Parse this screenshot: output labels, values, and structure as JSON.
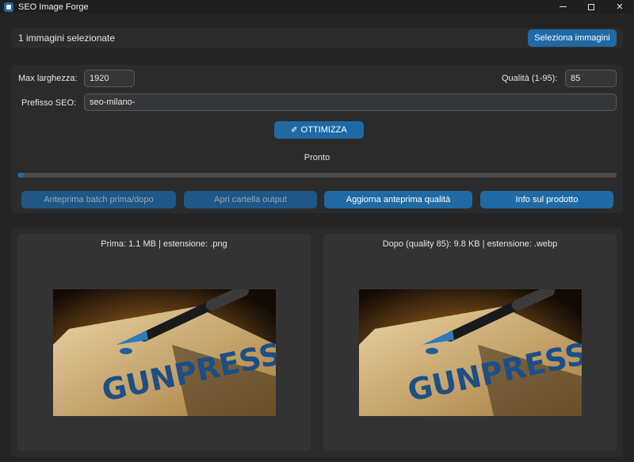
{
  "window": {
    "title": "SEO Image Forge",
    "icon": "app-icon"
  },
  "selection": {
    "label": "1 immagini selezionate",
    "select_button": "Seleziona immagini"
  },
  "settings": {
    "max_width_label": "Max larghezza:",
    "max_width_value": "1920",
    "quality_label": "Qualità (1-95):",
    "quality_value": "85",
    "prefix_label": "Prefisso SEO:",
    "prefix_value": "seo-milano-",
    "optimize_button": "OTTIMIZZA",
    "optimize_icon": "magic-wand-icon",
    "status": "Pronto",
    "progress_fraction": 0.01
  },
  "actions": [
    {
      "label": "Anteprima batch prima/dopo",
      "enabled": false
    },
    {
      "label": "Apri cartella output",
      "enabled": false
    },
    {
      "label": "Aggiorna anteprima qualità",
      "enabled": true
    },
    {
      "label": "Info sul prodotto",
      "enabled": true
    }
  ],
  "preview": {
    "before_caption": "Prima: 1.1 MB  |  estensione: .png",
    "after_caption": "Dopo (quality 85): 9.8 KB  |  estensione: .webp",
    "image_text": "GUNPRESS"
  },
  "colors": {
    "accent": "#1f6aa5",
    "background": "#242424",
    "frame": "#2b2b2b"
  }
}
